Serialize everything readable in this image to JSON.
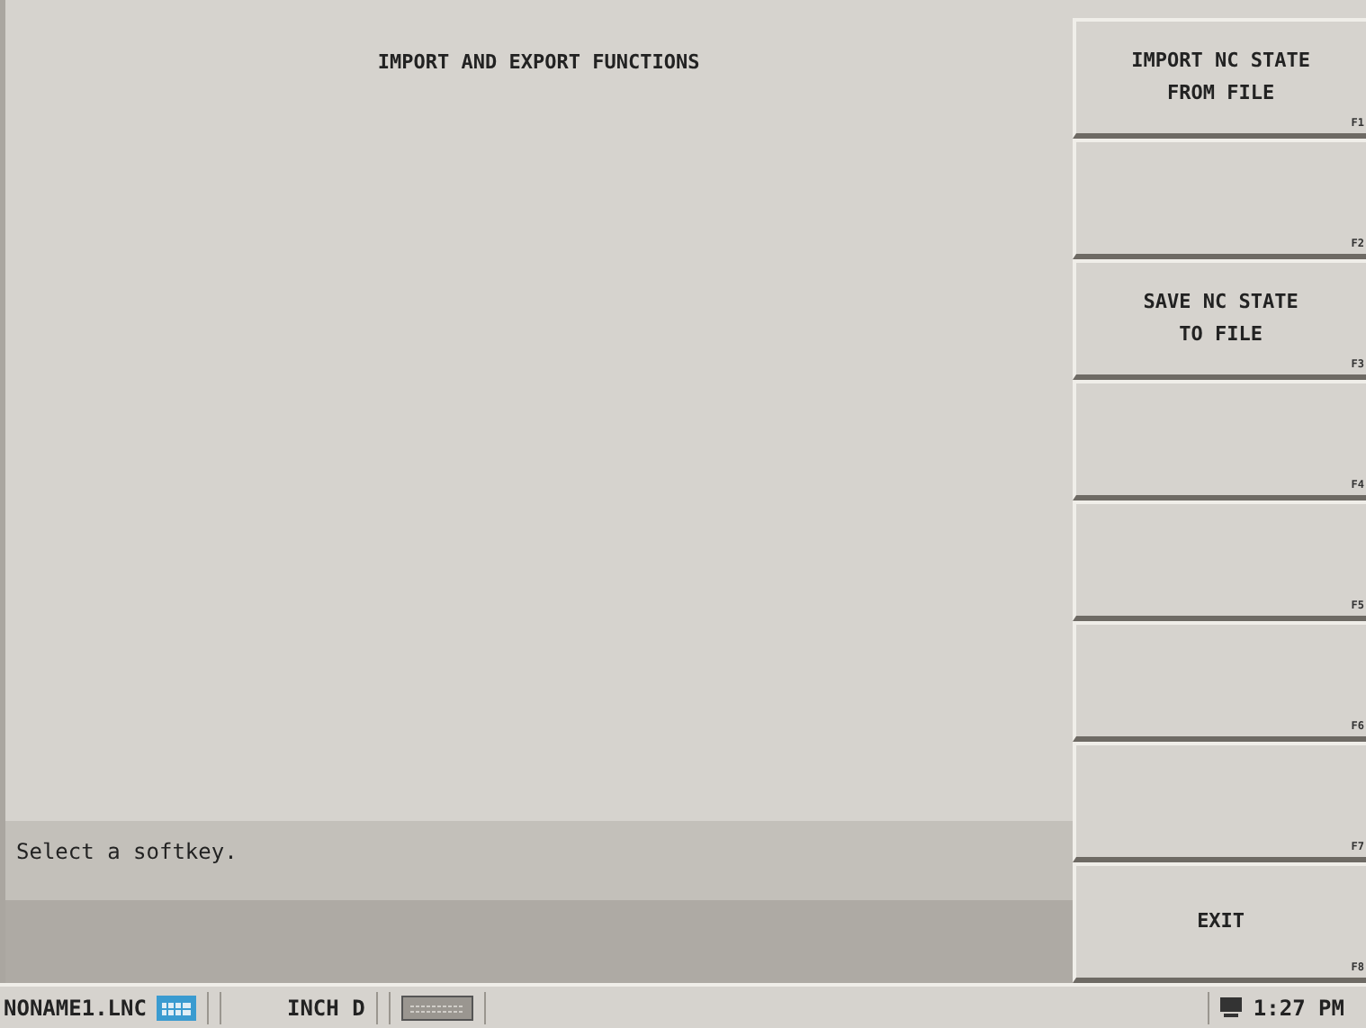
{
  "screen": {
    "title": "IMPORT AND EXPORT FUNCTIONS"
  },
  "message": "Select a softkey.",
  "softkeys": [
    {
      "label": "IMPORT NC STATE FROM FILE",
      "key": "F1"
    },
    {
      "key": "F2"
    },
    {
      "label": "SAVE NC STATE TO FILE",
      "key": "F3"
    },
    {
      "key": "F4"
    },
    {
      "key": "F5"
    },
    {
      "key": "F6"
    },
    {
      "key": "F7"
    },
    {
      "label": "EXIT",
      "key": "F8"
    }
  ],
  "status_bar": {
    "file": "NONAME1.LNC",
    "units": "INCH D",
    "time": "1:27 PM"
  }
}
